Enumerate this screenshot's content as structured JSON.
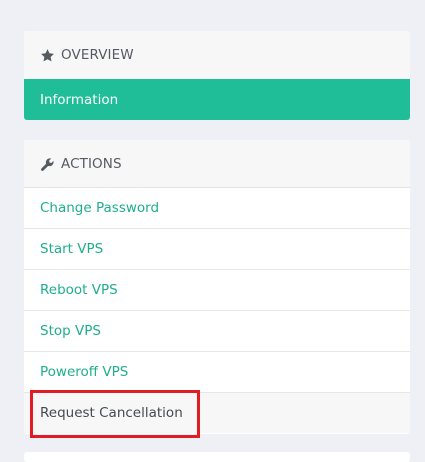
{
  "overview": {
    "heading": "OVERVIEW",
    "heading_icon": "star-icon",
    "active_item": "Information"
  },
  "actions": {
    "heading": "ACTIONS",
    "heading_icon": "wrench-icon",
    "items": [
      {
        "label": "Change Password"
      },
      {
        "label": "Start VPS"
      },
      {
        "label": "Reboot VPS"
      },
      {
        "label": "Stop VPS"
      },
      {
        "label": "Poweroff VPS"
      },
      {
        "label": "Request Cancellation"
      }
    ]
  },
  "colors": {
    "accent": "#1fbd98",
    "link": "#1fae8d",
    "highlight": "#e11d23",
    "background": "#eff0f5"
  }
}
